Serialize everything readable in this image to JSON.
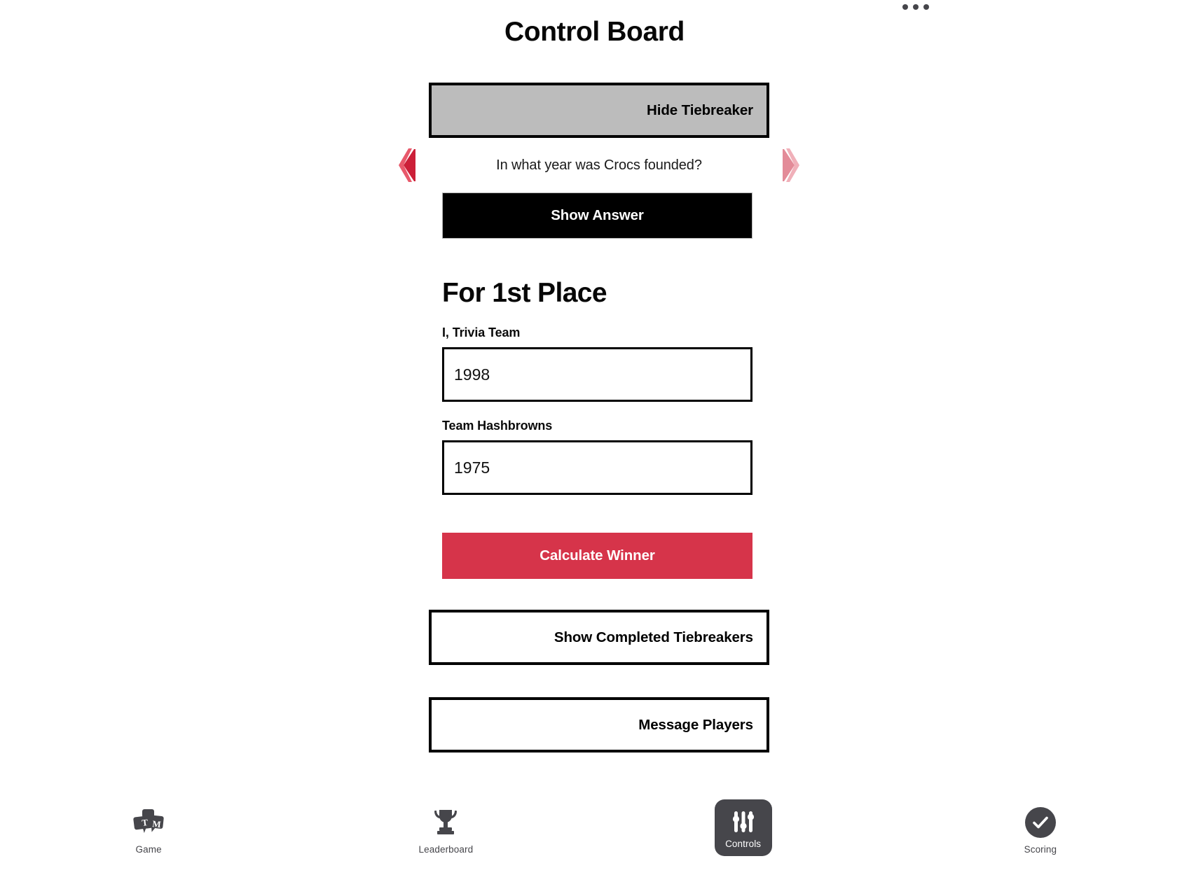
{
  "header": {
    "title": "Control Board",
    "menu_icon": "kebab-menu-icon"
  },
  "controls": {
    "toggle_tiebreaker_label": "Hide Tiebreaker",
    "question_text": "In what year was Crocs founded?",
    "prev_icon": "chevron-left-icon",
    "next_icon": "chevron-right-icon",
    "show_answer_label": "Show Answer",
    "show_completed_label": "Show Completed Tiebreakers",
    "message_players_label": "Message Players"
  },
  "tiebreaker": {
    "heading": "For 1st Place",
    "calculate_label": "Calculate Winner",
    "entries": [
      {
        "team": "I, Trivia Team",
        "answer": "1998",
        "placeholder": ""
      },
      {
        "team": "Team Hashbrowns",
        "answer": "1975",
        "placeholder": ""
      }
    ]
  },
  "tabbar": {
    "items": [
      {
        "label": "Game",
        "icon": "trivia-bubbles-icon",
        "active": false
      },
      {
        "label": "Leaderboard",
        "icon": "trophy-icon",
        "active": false
      },
      {
        "label": "Controls",
        "icon": "sliders-icon",
        "active": true
      },
      {
        "label": "Scoring",
        "icon": "check-circle-icon",
        "active": false
      }
    ]
  },
  "colors": {
    "accent": "#d6344a",
    "accent_light": "#eda0ab",
    "toggle_bg": "#bcbcbc",
    "dark": "#46464b",
    "black": "#000000"
  }
}
